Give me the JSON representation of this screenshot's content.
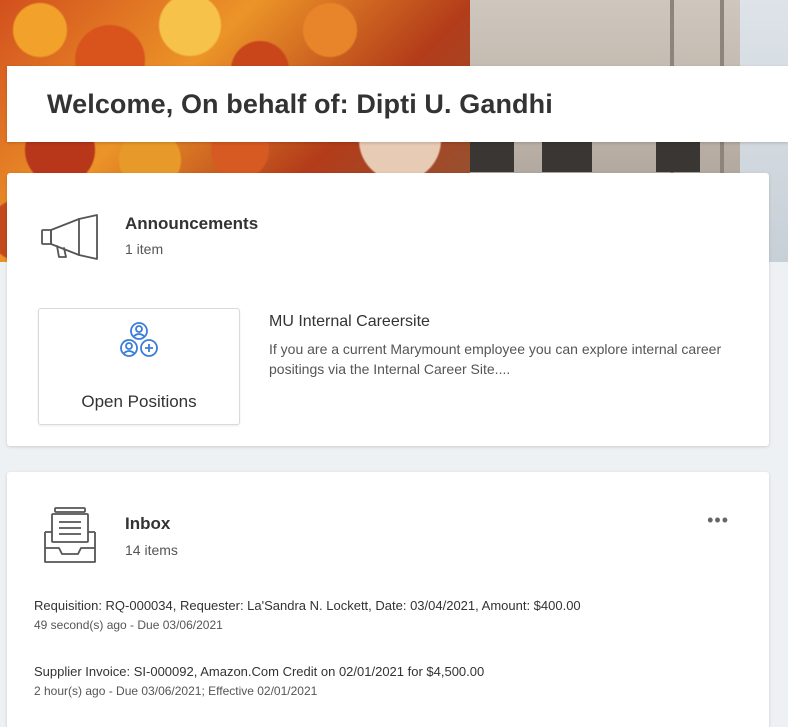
{
  "welcome": {
    "title": "Welcome, On behalf of: Dipti U. Gandhi"
  },
  "announcements": {
    "title": "Announcements",
    "count": "1 item",
    "icon": "megaphone-icon",
    "tile": {
      "label": "Open Positions",
      "icon": "people-add-icon",
      "icon_color": "#3b7dd8"
    },
    "item": {
      "title": "MU Internal Careersite",
      "description": "If you are a current Marymount employee you can explore internal career positings via the Internal Career Site...."
    }
  },
  "inbox": {
    "title": "Inbox",
    "count": "14 items",
    "icon": "inbox-tray-icon",
    "more_label": "•••",
    "items": [
      {
        "title": "Requisition: RQ-000034, Requester: La'Sandra N. Lockett, Date: 03/04/2021, Amount: $400.00",
        "meta": "49 second(s) ago - Due 03/06/2021"
      },
      {
        "title": "Supplier Invoice: SI-000092, Amazon.Com Credit on 02/01/2021 for $4,500.00",
        "meta": "2 hour(s) ago - Due 03/06/2021; Effective 02/01/2021"
      }
    ]
  }
}
